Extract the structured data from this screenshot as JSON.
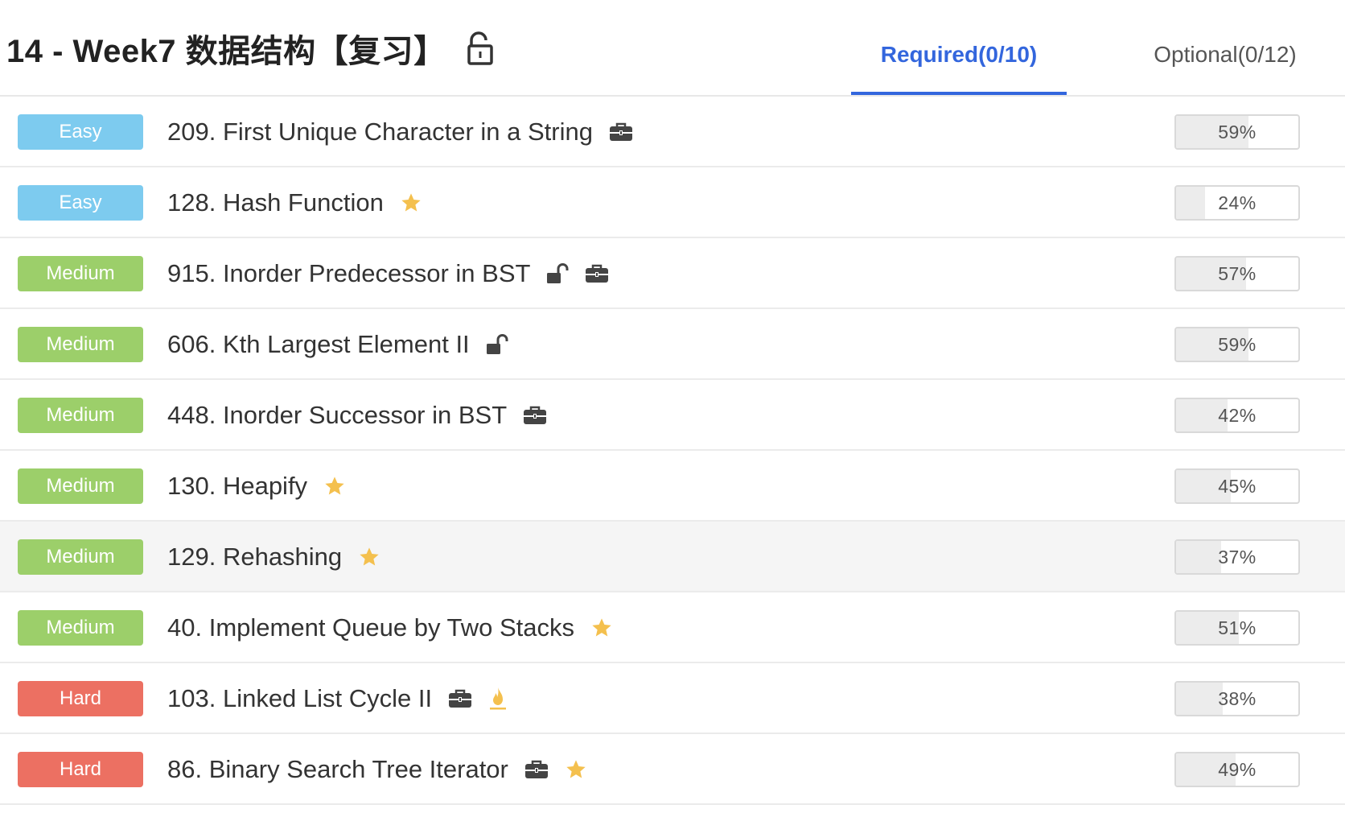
{
  "header": {
    "title": "14 - Week7 数据结构【复习】",
    "lock_icon": "lock-open-icon"
  },
  "tabs": [
    {
      "label": "Required(0/10)",
      "active": true
    },
    {
      "label": "Optional(0/12)",
      "active": false
    }
  ],
  "colors": {
    "accent": "#3366dd",
    "easy": "#7dcbef",
    "medium": "#9ccf6a",
    "hard": "#ec7062",
    "star": "#f4c04e"
  },
  "problems": [
    {
      "difficulty": "Easy",
      "title": "209. First Unique Character in a String",
      "icons": [
        "briefcase-icon"
      ],
      "rate": "59%",
      "rate_value": 59
    },
    {
      "difficulty": "Easy",
      "title": "128. Hash Function",
      "icons": [
        "star-icon"
      ],
      "rate": "24%",
      "rate_value": 24
    },
    {
      "difficulty": "Medium",
      "title": "915. Inorder Predecessor in BST",
      "icons": [
        "unlock-icon",
        "briefcase-icon"
      ],
      "rate": "57%",
      "rate_value": 57
    },
    {
      "difficulty": "Medium",
      "title": "606. Kth Largest Element II",
      "icons": [
        "unlock-icon"
      ],
      "rate": "59%",
      "rate_value": 59
    },
    {
      "difficulty": "Medium",
      "title": "448. Inorder Successor in BST",
      "icons": [
        "briefcase-icon"
      ],
      "rate": "42%",
      "rate_value": 42
    },
    {
      "difficulty": "Medium",
      "title": "130. Heapify",
      "icons": [
        "star-icon"
      ],
      "rate": "45%",
      "rate_value": 45
    },
    {
      "difficulty": "Medium",
      "title": "129. Rehashing",
      "icons": [
        "star-icon"
      ],
      "rate": "37%",
      "rate_value": 37,
      "highlighted": true
    },
    {
      "difficulty": "Medium",
      "title": "40. Implement Queue by Two Stacks",
      "icons": [
        "star-icon"
      ],
      "rate": "51%",
      "rate_value": 51
    },
    {
      "difficulty": "Hard",
      "title": "103. Linked List Cycle II",
      "icons": [
        "briefcase-icon",
        "flame-icon"
      ],
      "rate": "38%",
      "rate_value": 38
    },
    {
      "difficulty": "Hard",
      "title": "86. Binary Search Tree Iterator",
      "icons": [
        "briefcase-icon",
        "star-icon"
      ],
      "rate": "49%",
      "rate_value": 49
    }
  ]
}
